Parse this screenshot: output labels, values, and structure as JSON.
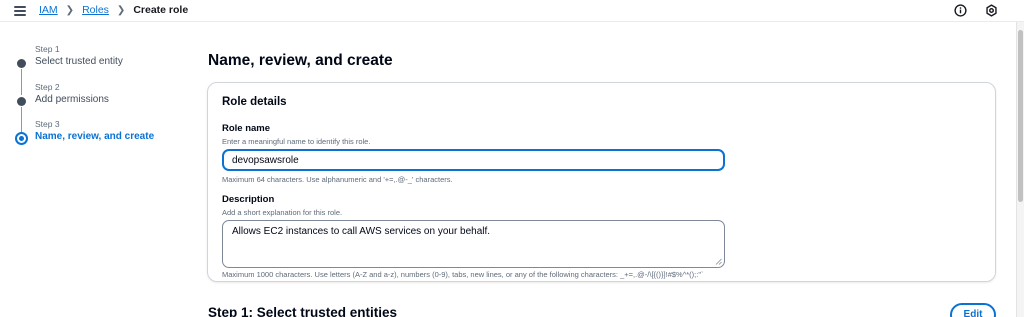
{
  "breadcrumb": {
    "items": [
      "IAM",
      "Roles"
    ],
    "current": "Create role"
  },
  "icons": {
    "menu": "hamburger-menu-icon",
    "info": "info-circle-icon",
    "settings": "settings-gear-icon"
  },
  "steps": [
    {
      "number": "Step 1",
      "label": "Select trusted entity",
      "state": "completed"
    },
    {
      "number": "Step 2",
      "label": "Add permissions",
      "state": "completed"
    },
    {
      "number": "Step 3",
      "label": "Name, review, and create",
      "state": "active"
    }
  ],
  "main": {
    "title": "Name, review, and create",
    "role_details": {
      "heading": "Role details",
      "role_name": {
        "label": "Role name",
        "description": "Enter a meaningful name to identify this role.",
        "value": "devopsawsrole",
        "constraint": "Maximum 64 characters. Use alphanumeric and '+=,.@-_' characters."
      },
      "description": {
        "label": "Description",
        "description": "Add a short explanation for this role.",
        "value": "Allows EC2 instances to call AWS services on your behalf.",
        "constraint": "Maximum 1000 characters. Use letters (A-Z and a-z), numbers (0-9), tabs, new lines, or any of the following characters: _+=,.@-/\\[{()}]!#$%^*();:\"`"
      }
    },
    "step1_section": {
      "heading": "Step 1: Select trusted entities",
      "edit_label": "Edit"
    }
  },
  "colors": {
    "accent": "#0972d3",
    "text": "#000716",
    "muted": "#5f6b7a"
  }
}
